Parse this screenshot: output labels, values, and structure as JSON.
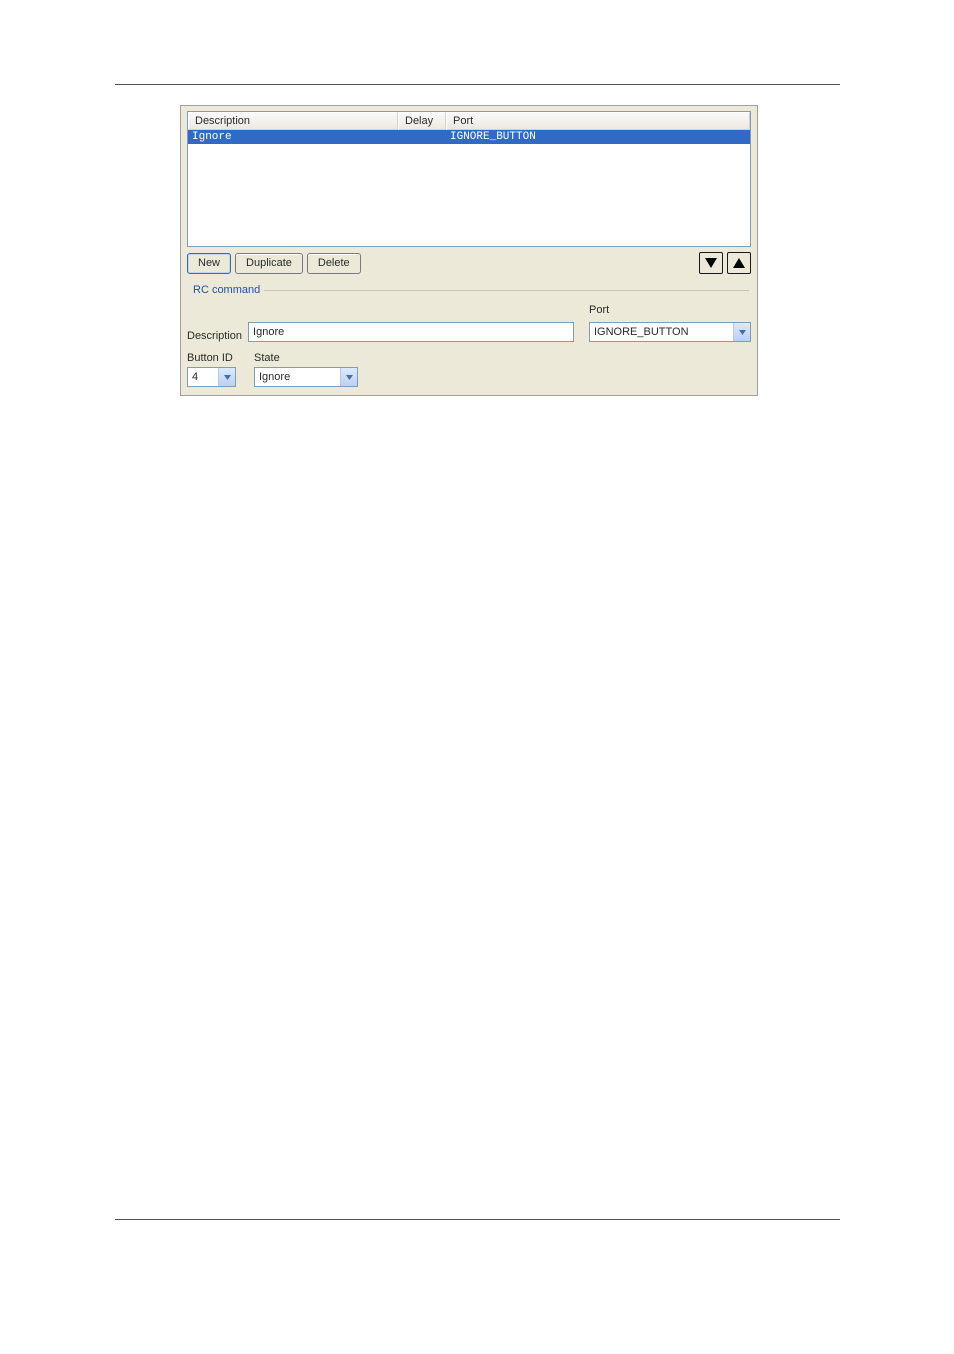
{
  "table": {
    "headers": {
      "description": "Description",
      "delay": "Delay",
      "port": "Port"
    },
    "rows": [
      {
        "description": "Ignore",
        "delay": "",
        "port": "IGNORE_BUTTON"
      }
    ]
  },
  "buttons": {
    "new": "New",
    "duplicate": "Duplicate",
    "delete": "Delete"
  },
  "rc": {
    "legend": "RC command",
    "description_label": "Description",
    "description_value": "Ignore",
    "port_label": "Port",
    "port_value": "IGNORE_BUTTON",
    "buttonid_label": "Button ID",
    "buttonid_value": "4",
    "state_label": "State",
    "state_value": "Ignore"
  }
}
